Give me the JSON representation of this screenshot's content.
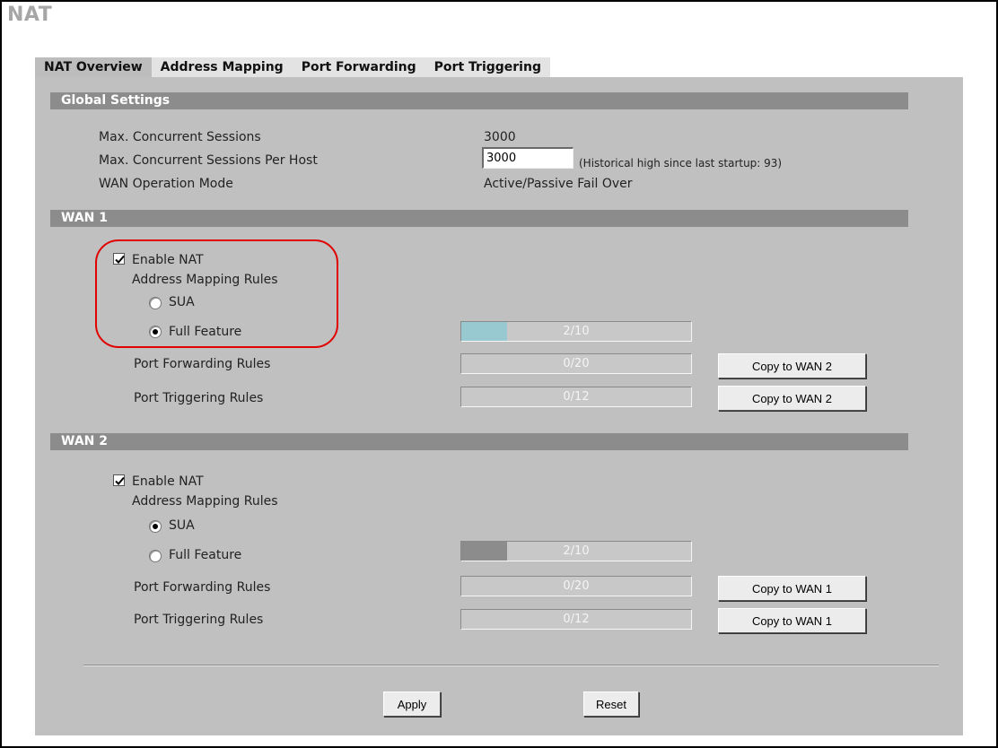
{
  "page": {
    "title": "NAT"
  },
  "tabs": [
    {
      "label": "NAT Overview",
      "active": true
    },
    {
      "label": "Address Mapping",
      "active": false
    },
    {
      "label": "Port Forwarding",
      "active": false
    },
    {
      "label": "Port Triggering",
      "active": false
    }
  ],
  "global": {
    "header": "Global Settings",
    "max_sessions_label": "Max. Concurrent Sessions",
    "max_sessions_value": "3000",
    "max_per_host_label": "Max. Concurrent Sessions Per Host",
    "max_per_host_value": "3000",
    "historical_note": "(Historical high since last startup: 93)",
    "wan_mode_label": "WAN Operation Mode",
    "wan_mode_value": "Active/Passive Fail Over"
  },
  "wan1": {
    "header": "WAN 1",
    "enable_label": "Enable NAT",
    "enable_checked": true,
    "mapping_label": "Address Mapping Rules",
    "sua_label": "SUA",
    "full_label": "Full Feature",
    "selected": "Full Feature",
    "full_usage": "2/10",
    "full_fraction": 0.2,
    "pf_label": "Port Forwarding Rules",
    "pf_usage": "0/20",
    "pf_copy": "Copy to WAN 2",
    "pt_label": "Port Triggering Rules",
    "pt_usage": "0/12",
    "pt_copy": "Copy to WAN 2"
  },
  "wan2": {
    "header": "WAN 2",
    "enable_label": "Enable NAT",
    "enable_checked": true,
    "mapping_label": "Address Mapping Rules",
    "sua_label": "SUA",
    "full_label": "Full Feature",
    "selected": "SUA",
    "full_usage": "2/10",
    "full_fraction": 0.2,
    "pf_label": "Port Forwarding Rules",
    "pf_usage": "0/20",
    "pf_copy": "Copy to WAN 1",
    "pt_label": "Port Triggering Rules",
    "pt_usage": "0/12",
    "pt_copy": "Copy to WAN 1"
  },
  "actions": {
    "apply": "Apply",
    "reset": "Reset"
  },
  "colors": {
    "wan1_bar_fill": "#98c8d0",
    "wan2_bar_fill": "#8c8c8c",
    "highlight": "#e00000",
    "header_bg": "#8c8c8c"
  }
}
